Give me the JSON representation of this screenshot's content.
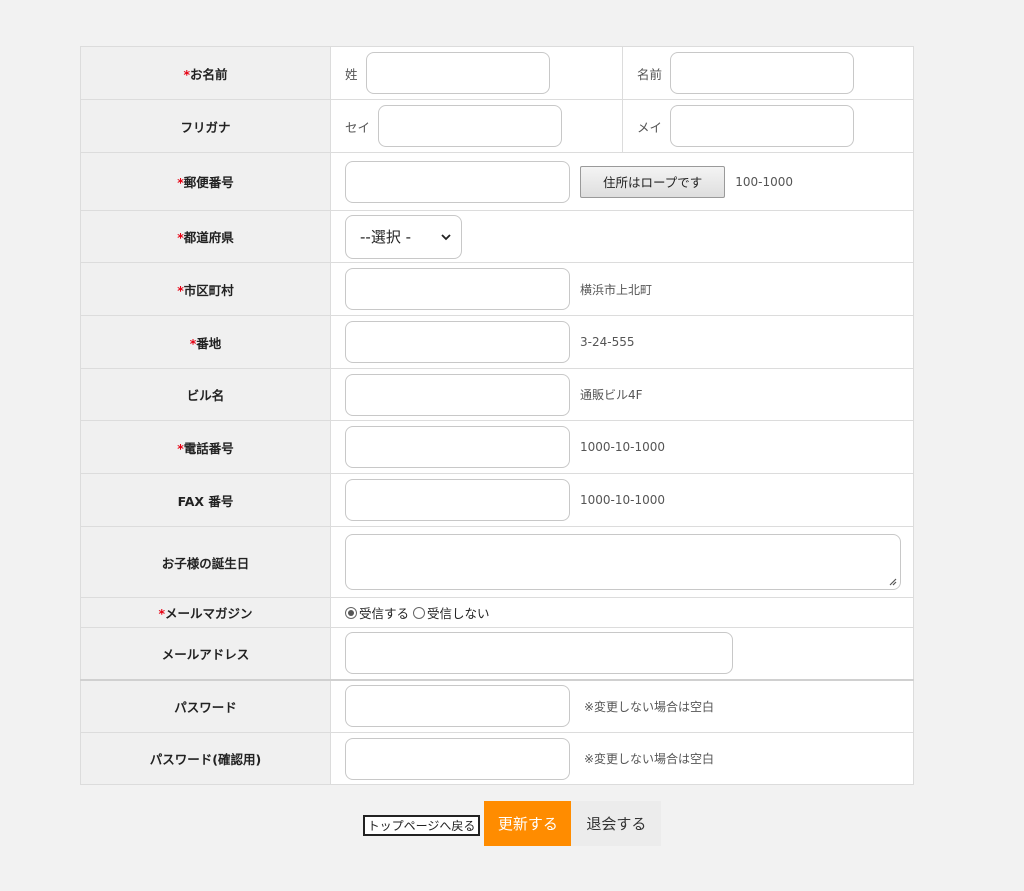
{
  "rows": {
    "name": {
      "label": "お名前",
      "required_mark": "*",
      "sei_label": "姓",
      "mei_label": "名前",
      "sei_value": "",
      "mei_value": ""
    },
    "furigana": {
      "label": "フリガナ",
      "sei_label": "セイ",
      "mei_label": "メイ",
      "sei_value": "",
      "mei_value": ""
    },
    "zip": {
      "label": "郵便番号",
      "required_mark": "*",
      "value": "",
      "button": "住所はロープです",
      "hint": "100-1000"
    },
    "prefecture": {
      "label": "都道府県",
      "required_mark": "*",
      "selected": "--選択 -"
    },
    "city": {
      "label": "市区町村",
      "required_mark": "*",
      "value": "",
      "hint": "横浜市上北町"
    },
    "address": {
      "label": "番地",
      "required_mark": "*",
      "value": "",
      "hint": "3-24-555"
    },
    "building": {
      "label": "ビル名",
      "value": "",
      "hint": "通販ビル4F"
    },
    "phone": {
      "label": "電話番号",
      "required_mark": "*",
      "value": "",
      "hint": "1000-10-1000"
    },
    "fax": {
      "label": "FAX 番号",
      "value": "",
      "hint": "1000-10-1000"
    },
    "child_birthday": {
      "label": "お子様の誕生日",
      "value": ""
    },
    "mail_magazine": {
      "label": "メールマガジン",
      "required_mark": "*",
      "option_yes": "受信する",
      "option_no": "受信しない",
      "selected": "受信する"
    },
    "email": {
      "label": "メールアドレス",
      "value": ""
    },
    "password": {
      "label": "パスワード",
      "value": "",
      "hint": "※変更しない場合は空白"
    },
    "password_confirm": {
      "label": "パスワード(確認用)",
      "value": "",
      "hint": "※変更しない場合は空白"
    }
  },
  "buttons": {
    "back": "トップページへ戻る",
    "update": "更新する",
    "withdraw": "退会する"
  },
  "colors": {
    "required": "#e60012",
    "update_button": "#ff8c00",
    "header_cell": "#f0f0f0",
    "page_background": "#f2f2f2"
  }
}
